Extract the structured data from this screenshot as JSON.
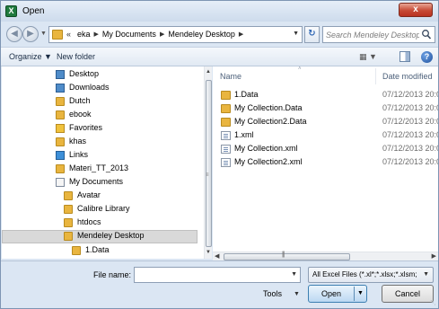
{
  "window": {
    "title": "Open",
    "app_icon_glyph": "X",
    "close_glyph": "x"
  },
  "address": {
    "overflow_glyph": "«",
    "breadcrumbs": [
      "eka",
      "My Documents",
      "Mendeley Desktop"
    ],
    "search_placeholder": "Search Mendeley Desktop"
  },
  "toolbar": {
    "organize_label": "Organize",
    "new_folder_label": "New folder",
    "help_glyph": "?"
  },
  "nav": {
    "items": [
      {
        "label": "Desktop",
        "icon": "desktop-icon"
      },
      {
        "label": "Downloads",
        "icon": "downloads-icon"
      },
      {
        "label": "Dutch",
        "icon": "folder-icon"
      },
      {
        "label": "ebook",
        "icon": "folder-icon"
      },
      {
        "label": "Favorites",
        "icon": "favorites-icon"
      },
      {
        "label": "khas",
        "icon": "folder-icon"
      },
      {
        "label": "Links",
        "icon": "links-icon"
      },
      {
        "label": "Materi_TT_2013",
        "icon": "folder-icon"
      },
      {
        "label": "My Documents",
        "icon": "documents-icon"
      },
      {
        "label": "Avatar",
        "icon": "folder-icon"
      },
      {
        "label": "Calibre Library",
        "icon": "folder-icon"
      },
      {
        "label": "htdocs",
        "icon": "folder-icon"
      },
      {
        "label": "Mendeley Desktop",
        "icon": "folder-icon",
        "selected": true
      },
      {
        "label": "1.Data",
        "icon": "folder-icon"
      }
    ]
  },
  "content": {
    "columns": {
      "name": "Name",
      "date": "Date modified"
    },
    "files": [
      {
        "name": "1.Data",
        "date": "07/12/2013 20:0",
        "icon": "folder-icon"
      },
      {
        "name": "My Collection.Data",
        "date": "07/12/2013 20:0",
        "icon": "folder-icon"
      },
      {
        "name": "My Collection2.Data",
        "date": "07/12/2013 20:0",
        "icon": "folder-icon"
      },
      {
        "name": "1.xml",
        "date": "07/12/2013 20:0",
        "icon": "xml-file-icon"
      },
      {
        "name": "My Collection.xml",
        "date": "07/12/2013 20:0",
        "icon": "xml-file-icon"
      },
      {
        "name": "My Collection2.xml",
        "date": "07/12/2013 20:0",
        "icon": "xml-file-icon"
      }
    ]
  },
  "bottom": {
    "file_name_label": "File name:",
    "file_name_value": "",
    "file_type": "All Excel Files (*.xl*;*.xlsx;*.xlsm;",
    "tools_label": "Tools",
    "open_label": "Open",
    "cancel_label": "Cancel"
  }
}
